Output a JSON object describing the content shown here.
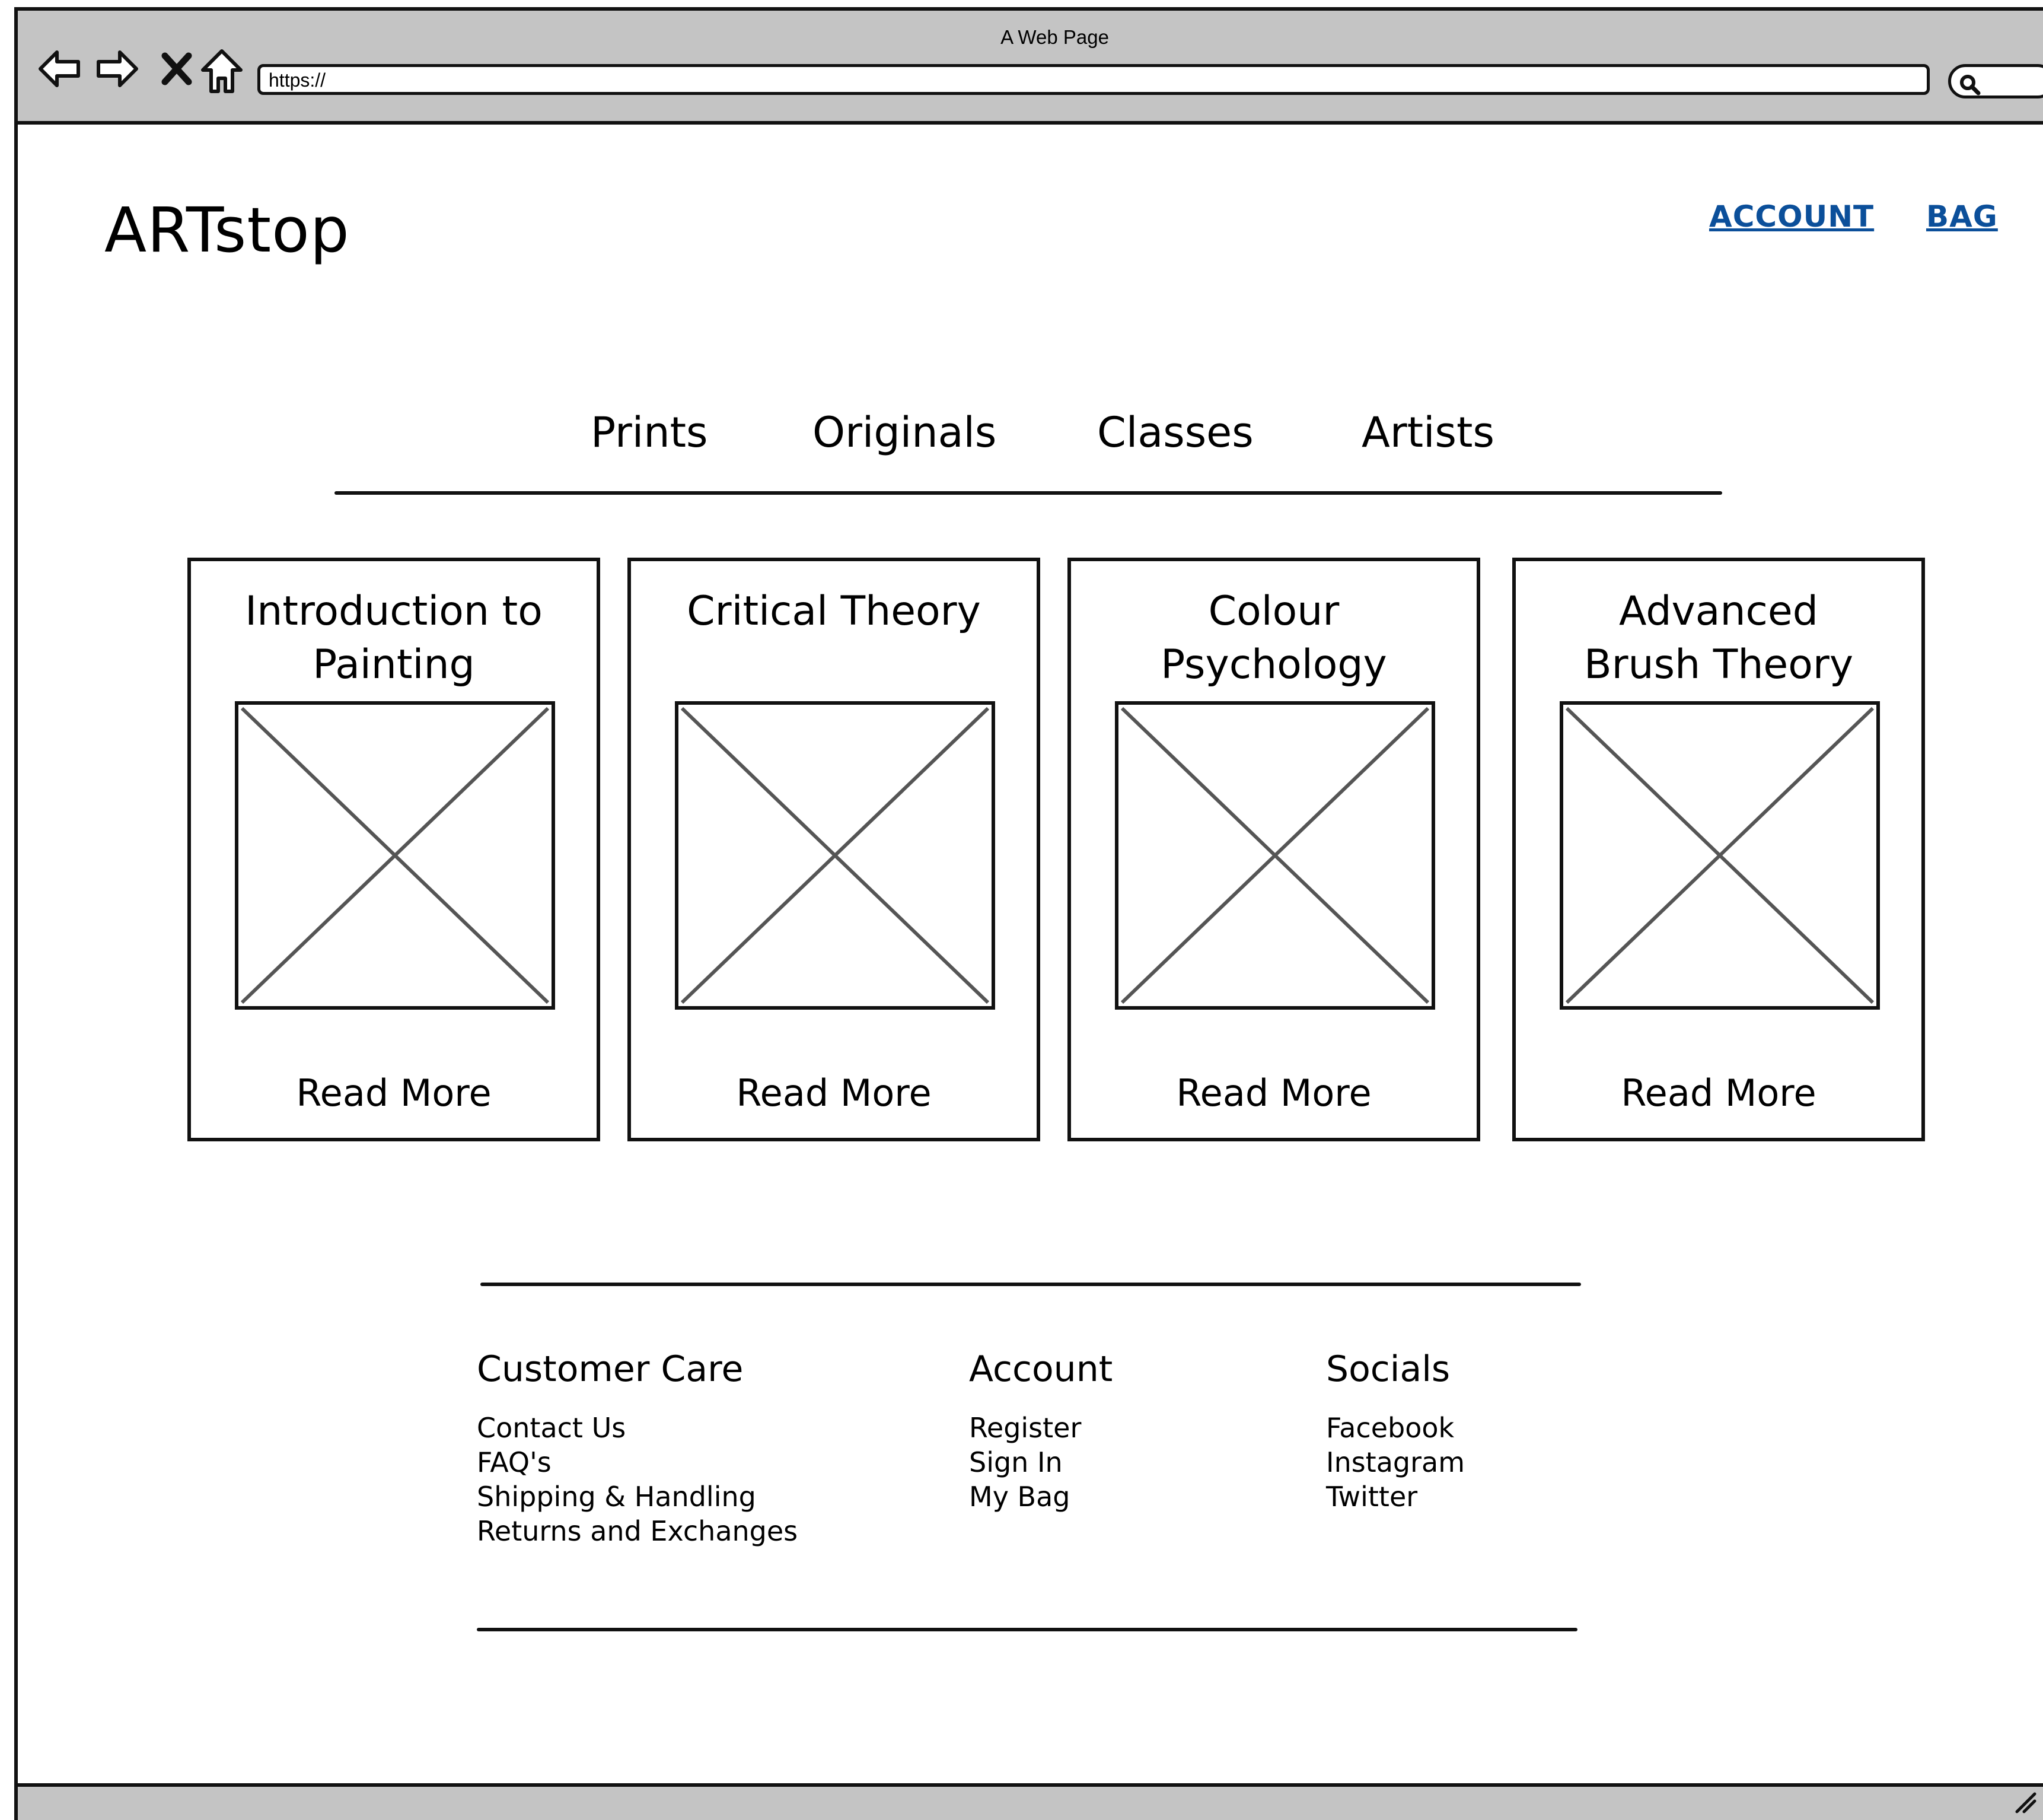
{
  "browser": {
    "title": "A Web Page",
    "url": "https://"
  },
  "header": {
    "logo": "ARTstop",
    "links": [
      "ACCOUNT",
      "BAG"
    ],
    "link_color": "#0b4f9a"
  },
  "nav": {
    "items": [
      "Prints",
      "Originals",
      "Classes",
      "Artists"
    ]
  },
  "cards": [
    {
      "title_lines": [
        "Introduction to",
        "Painting"
      ],
      "action": "Read More"
    },
    {
      "title_lines": [
        "Critical Theory",
        ""
      ],
      "action": "Read More"
    },
    {
      "title_lines": [
        "Colour",
        "Psychology"
      ],
      "action": "Read More"
    },
    {
      "title_lines": [
        "Advanced",
        "Brush Theory"
      ],
      "action": "Read More"
    }
  ],
  "footer": {
    "columns": [
      {
        "heading": "Customer Care",
        "links": [
          "Contact Us",
          "FAQ's",
          "Shipping & Handling",
          "Returns and Exchanges"
        ]
      },
      {
        "heading": "Account",
        "links": [
          "Register",
          "Sign In",
          "My Bag"
        ]
      },
      {
        "heading": "Socials",
        "links": [
          "Facebook",
          "Instagram",
          "Twitter"
        ]
      }
    ]
  },
  "icons": [
    "back-arrow-icon",
    "forward-arrow-icon",
    "close-icon",
    "home-icon",
    "search-icon",
    "resize-grip-icon",
    "image-placeholder-icon"
  ]
}
